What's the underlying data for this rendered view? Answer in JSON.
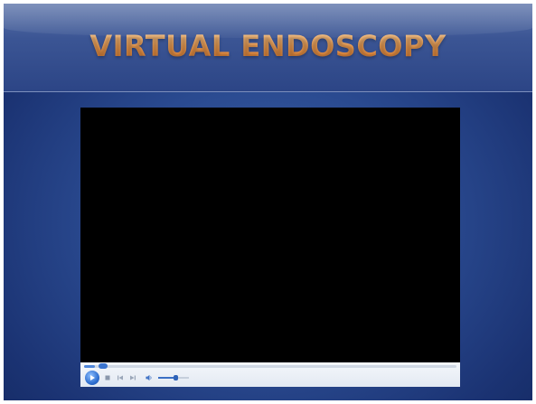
{
  "slide": {
    "title": "VIRTUAL ENDOSCOPY"
  },
  "player": {
    "seek_progress": 0.03,
    "volume_level": 0.55,
    "colors": {
      "accent": "#3a74cf",
      "controls_bg": "#e8edf4",
      "video_bg": "#000000"
    },
    "icons": {
      "play": "play-icon",
      "stop": "stop-icon",
      "previous": "previous-icon",
      "next": "next-icon",
      "volume": "volume-icon"
    }
  }
}
